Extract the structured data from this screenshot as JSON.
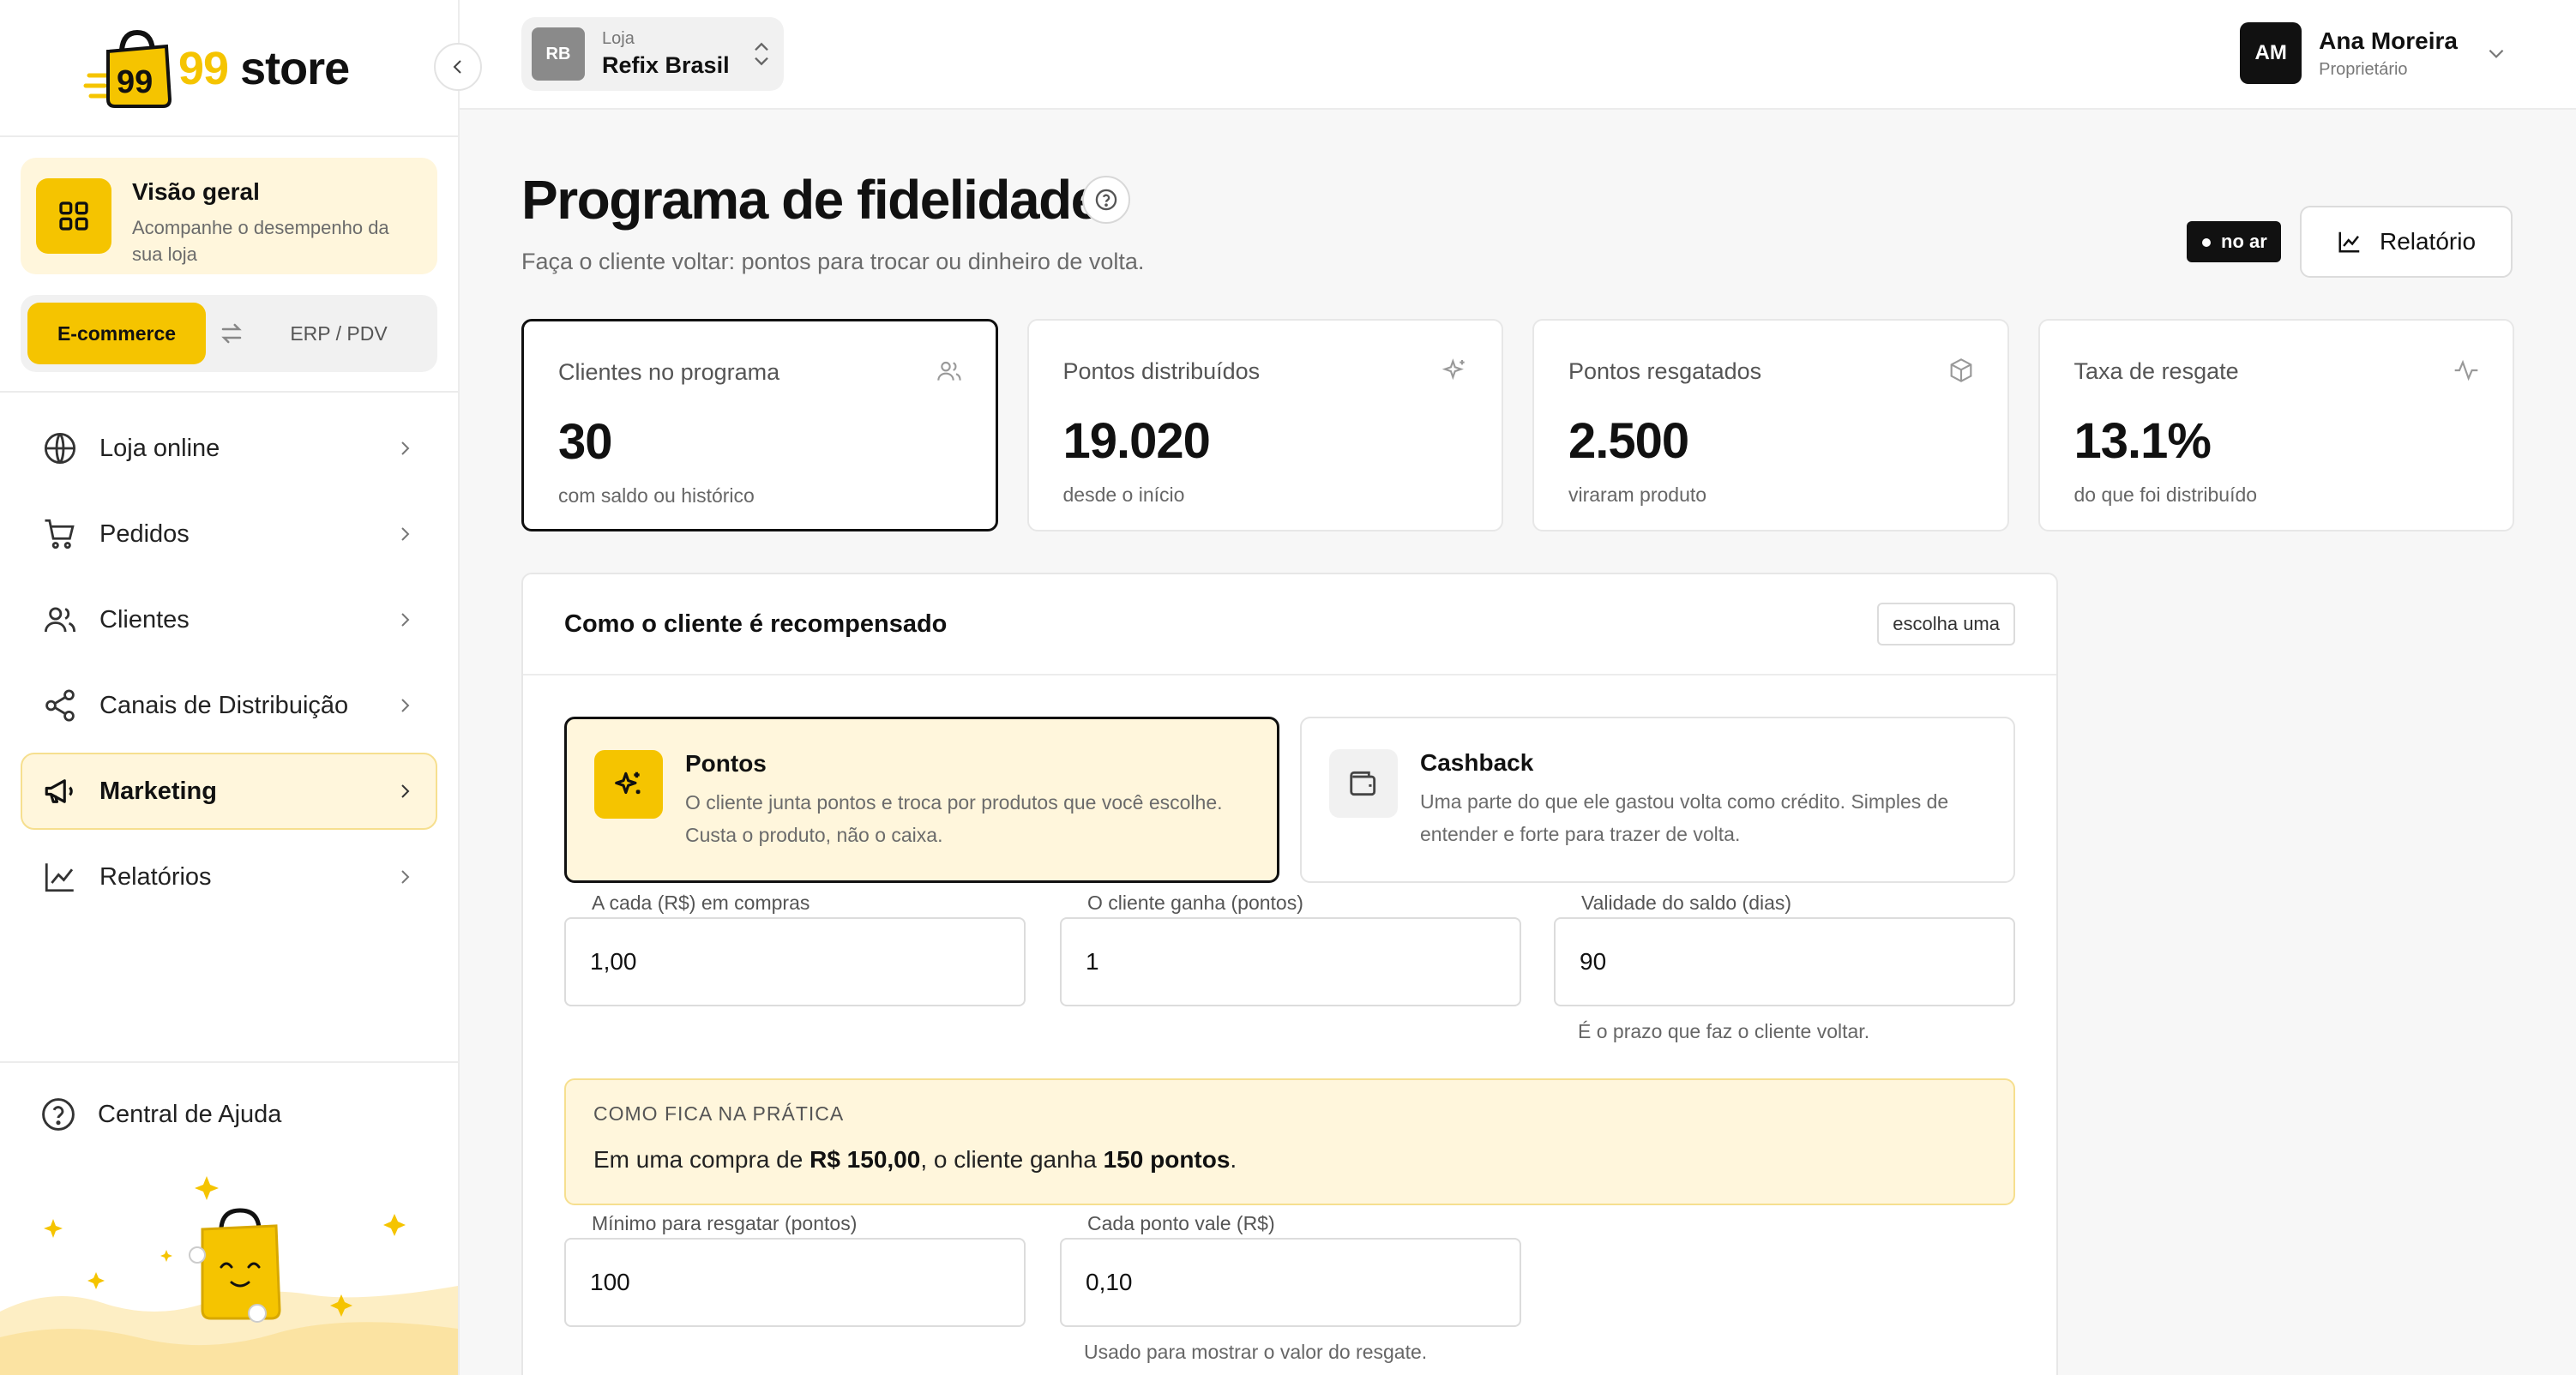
{
  "brand": {
    "logo_mark": "99",
    "name_number": "99",
    "name_word": " store"
  },
  "sidebar": {
    "overview": {
      "title": "Visão geral",
      "subtitle": "Acompanhe o desempenho da sua loja",
      "icon": "grid-icon"
    },
    "mode": {
      "active": "E-commerce",
      "inactive": "ERP / PDV"
    },
    "items": [
      {
        "label": "Loja online",
        "icon": "globe-icon"
      },
      {
        "label": "Pedidos",
        "icon": "cart-icon"
      },
      {
        "label": "Clientes",
        "icon": "users-icon"
      },
      {
        "label": "Canais de Distribuição",
        "icon": "share-icon"
      },
      {
        "label": "Marketing",
        "icon": "megaphone-icon",
        "active": true
      },
      {
        "label": "Relatórios",
        "icon": "chart-icon"
      }
    ],
    "help": {
      "label": "Central de Ajuda",
      "icon": "help-icon"
    }
  },
  "topbar": {
    "store": {
      "label": "Loja",
      "name": "Refix Brasil",
      "initials": "RB"
    },
    "user": {
      "name": "Ana Moreira",
      "role": "Proprietário",
      "initials": "AM"
    }
  },
  "page": {
    "title": "Programa de fidelidade",
    "subtitle": "Faça o cliente voltar: pontos para trocar ou dinheiro de volta.",
    "status": "no ar",
    "report_button": "Relatório"
  },
  "stats": [
    {
      "label": "Clientes no programa",
      "value": "30",
      "note": "com saldo ou histórico",
      "icon": "users-icon"
    },
    {
      "label": "Pontos distribuídos",
      "value": "19.020",
      "note": "desde o início",
      "icon": "sparkle-icon"
    },
    {
      "label": "Pontos resgatados",
      "value": "2.500",
      "note": "viraram produto",
      "icon": "box-icon"
    },
    {
      "label": "Taxa de resgate",
      "value": "13.1%",
      "note": "do que foi distribuído",
      "icon": "activity-icon"
    }
  ],
  "reward": {
    "title": "Como o cliente é recompensado",
    "tag": "escolha uma",
    "options": [
      {
        "title": "Pontos",
        "desc": "O cliente junta pontos e troca por produtos que você escolhe. Custa o produto, não o caixa.",
        "selected": true
      },
      {
        "title": "Cashback",
        "desc": "Uma parte do que ele gastou volta como crédito. Simples de entender e forte para trazer de volta.",
        "selected": false
      }
    ],
    "fields": {
      "spend": {
        "label": "A cada (R$) em compras",
        "value": "1,00"
      },
      "earn": {
        "label": "O cliente ganha (pontos)",
        "value": "1"
      },
      "validity": {
        "label": "Validade do saldo (dias)",
        "value": "90",
        "help": "É o prazo que faz o cliente voltar."
      },
      "min_redeem": {
        "label": "Mínimo para resgatar (pontos)",
        "value": "100"
      },
      "point_value": {
        "label": "Cada ponto vale (R$)",
        "value": "0,10",
        "help": "Usado para mostrar o valor do resgate."
      }
    },
    "practice": {
      "title": "COMO FICA NA PRÁTICA",
      "pre": "Em uma compra de ",
      "amount": "R$ 150,00",
      "mid": ", o cliente ganha ",
      "points": "150 pontos",
      "post": "."
    }
  },
  "colors": {
    "accent": "#f5c400",
    "accent_soft": "#fff6dc",
    "dark": "#111111"
  }
}
